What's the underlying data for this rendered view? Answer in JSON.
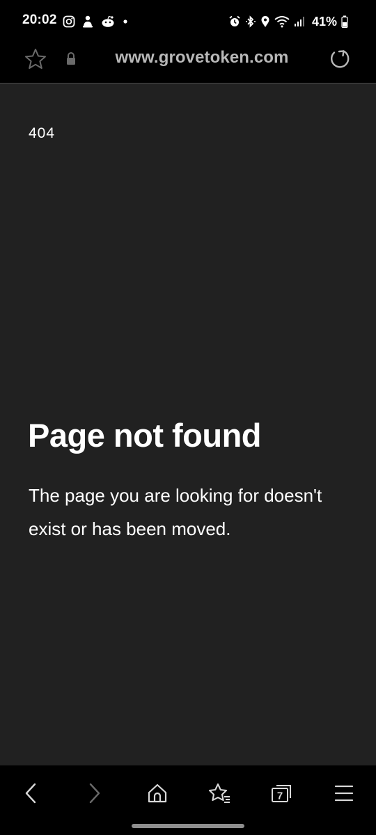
{
  "status_bar": {
    "time": "20:02",
    "left_icons": [
      "instagram-icon",
      "notification-app-icon",
      "reddit-icon",
      "more-dot-icon"
    ],
    "right_icons": [
      "alarm-icon",
      "bluetooth-icon",
      "location-icon",
      "wifi-icon",
      "signal-icon",
      "battery-icon"
    ],
    "battery": "41%"
  },
  "address_bar": {
    "url": "www.grovetoken.com",
    "icons": [
      "bookmark-star-icon",
      "lock-icon",
      "reload-icon"
    ]
  },
  "page": {
    "error_code": "404",
    "title": "Page not found",
    "message": "The page you are looking for doesn't exist or has been moved."
  },
  "toolbar": {
    "items": [
      {
        "name": "back",
        "icon": "chevron-left-icon"
      },
      {
        "name": "forward",
        "icon": "chevron-right-icon"
      },
      {
        "name": "home",
        "icon": "home-icon"
      },
      {
        "name": "bookmarks",
        "icon": "bookmarks-star-icon"
      },
      {
        "name": "tabs",
        "icon": "tabs-icon",
        "count": "7"
      },
      {
        "name": "menu",
        "icon": "menu-icon"
      }
    ]
  },
  "colors": {
    "page_background": "#212121",
    "chrome_background": "#000000",
    "url_text": "#b8b8b8",
    "icon_disabled": "#6a6a6a",
    "icon_active": "#d8d8d8"
  }
}
